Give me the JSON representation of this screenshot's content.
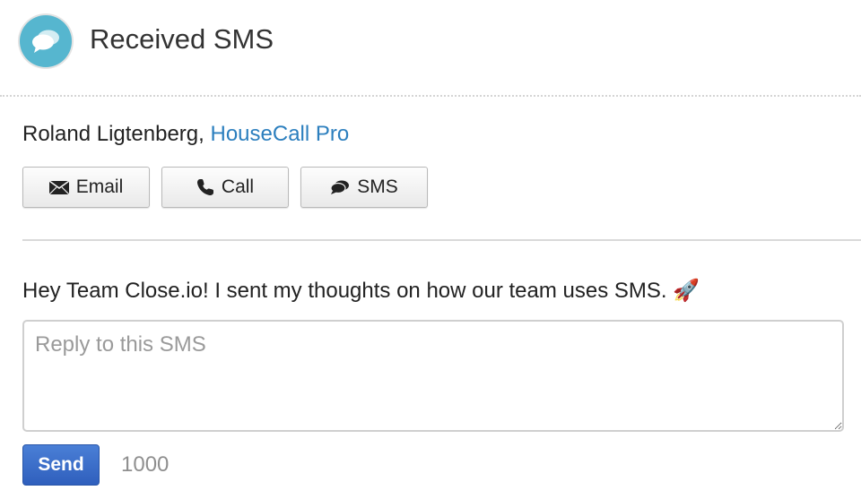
{
  "header": {
    "title": "Received SMS",
    "icon": "speech-bubbles-icon",
    "icon_bg_color": "#56b6cf"
  },
  "contact": {
    "name_prefix": "Roland Ligtenberg, ",
    "company": "HouseCall Pro",
    "company_color": "#2c7fbe"
  },
  "actions": {
    "email_label": "Email",
    "email_icon": "envelope-icon",
    "call_label": "Call",
    "call_icon": "phone-icon",
    "sms_label": "SMS",
    "sms_icon": "speech-bubbles-icon"
  },
  "message": {
    "text": "Hey Team Close.io! I sent my thoughts on how our team uses SMS. 🚀"
  },
  "reply": {
    "placeholder": "Reply to this SMS",
    "value": ""
  },
  "footer": {
    "send_label": "Send",
    "send_color": "#3468c6",
    "char_count": "1000"
  }
}
